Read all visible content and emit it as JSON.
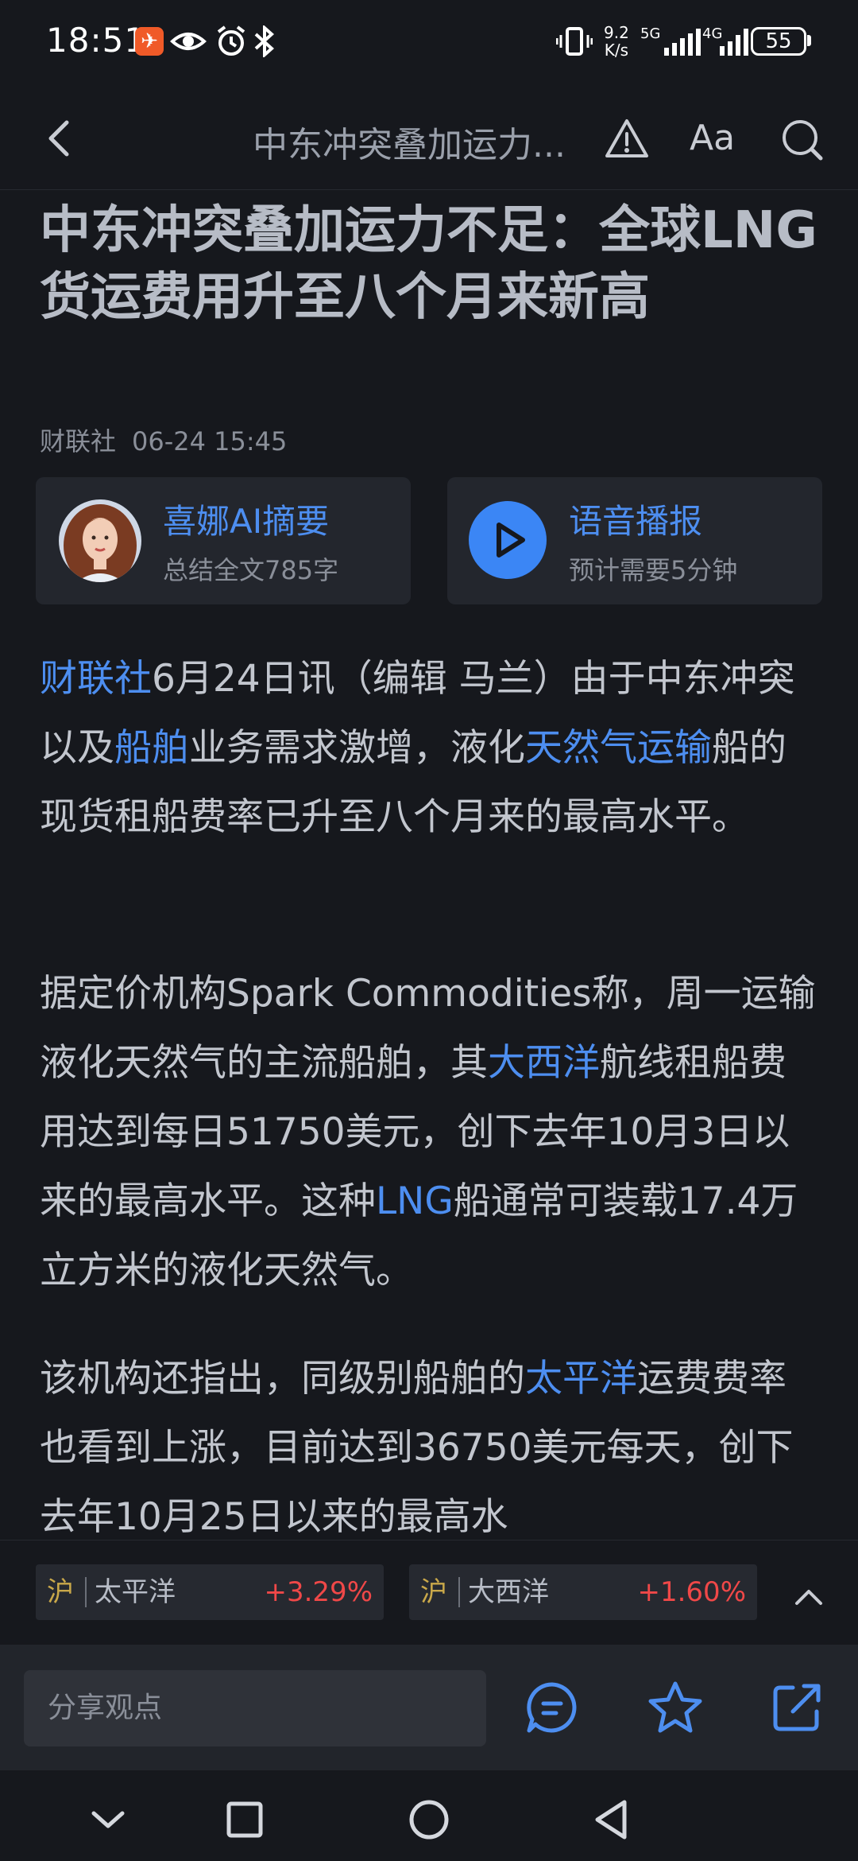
{
  "status_bar": {
    "time": "18:51",
    "net_speed_value": "9.2",
    "net_speed_unit": "K/s",
    "network_5g": "5G",
    "network_4g": "4G",
    "battery": "55",
    "icons": [
      "app-badge-icon",
      "eye-icon",
      "alarm-icon",
      "bluetooth-icon",
      "vibrate-icon",
      "signal-5g-icon",
      "signal-4g-icon",
      "battery-icon"
    ]
  },
  "header": {
    "title": "中东冲突叠加运力...",
    "font_label": "Aa"
  },
  "article": {
    "title": "中东冲突叠加运力不足：全球LNG货运费用升至八个月来新高",
    "source": "财联社",
    "datetime": "06-24 15:45"
  },
  "cards": {
    "ai_summary": {
      "title": "喜娜AI摘要",
      "subtitle": "总结全文785字"
    },
    "audio": {
      "title": "语音播报",
      "subtitle": "预计需要5分钟"
    }
  },
  "paragraphs": {
    "p1": {
      "s1": "财联社",
      "s2": "6月24日讯（编辑 马兰）由于中东冲突以及",
      "s3": "船舶",
      "s4": "业务需求激增，液化",
      "s5": "天然气运输",
      "s6": "船的现货租船费率已升至八个月来的最高水平。"
    },
    "p2": {
      "s1": "据定价机构Spark Commodities称，周一运输液化天然气的主流船舶，其",
      "s2": "大西洋",
      "s3": "航线租船费用达到每日51750美元，创下去年10月3日以来的最高水平。这种",
      "s4": "LNG",
      "s5": "船通常可装载17.4万立方米的液化天然气。"
    },
    "p3": {
      "s1": "该机构还指出，同级别船舶的",
      "s2": "太平洋",
      "s3": "运费费率也看到上涨，目前达到36750美元每天，创下去年10月25日以来的最高水"
    }
  },
  "stocks": [
    {
      "exchange": "沪",
      "name": "太平洋",
      "change": "+3.29%"
    },
    {
      "exchange": "沪",
      "name": "大西洋",
      "change": "+1.60%"
    }
  ],
  "action_bar": {
    "comment_placeholder": "分享观点"
  },
  "colors": {
    "background": "#16181d",
    "accent": "#4d8ef0",
    "rise": "#f04848",
    "exchange": "#c9a84a"
  }
}
